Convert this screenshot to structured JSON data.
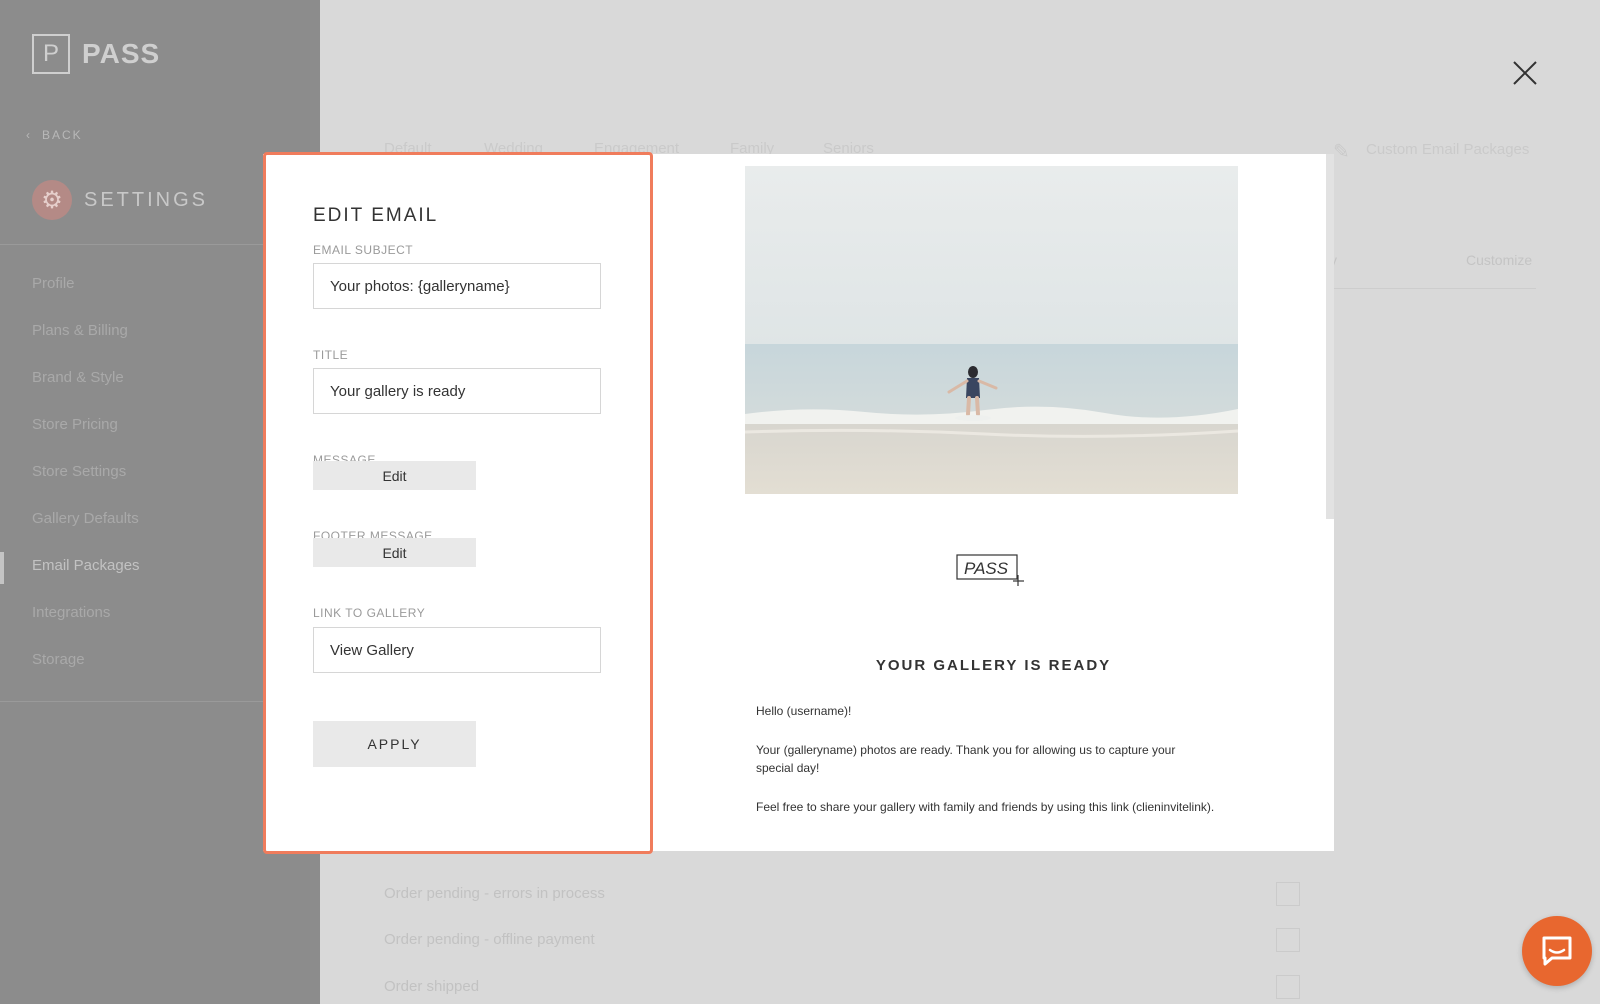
{
  "app": {
    "logo_mark": "P",
    "logo_text": "PASS",
    "back_label": "BACK",
    "section_title": "SETTINGS"
  },
  "sidebar": {
    "items": [
      {
        "label": "Profile"
      },
      {
        "label": "Plans & Billing"
      },
      {
        "label": "Brand & Style"
      },
      {
        "label": "Store Pricing"
      },
      {
        "label": "Store Settings"
      },
      {
        "label": "Gallery Defaults"
      },
      {
        "label": "Email Packages",
        "active": true
      },
      {
        "label": "Integrations"
      },
      {
        "label": "Storage"
      }
    ]
  },
  "background": {
    "tabs": [
      "Default",
      "Wedding",
      "Engagement",
      "Family",
      "Seniors"
    ],
    "custom_packages_label": "Custom Email Packages",
    "column_fragment": "y",
    "customize_label": "Customize",
    "rows": [
      "Order pending - errors in process",
      "Order pending - offline payment",
      "Order shipped"
    ]
  },
  "edit_form": {
    "title": "EDIT EMAIL",
    "email_subject_label": "EMAIL SUBJECT",
    "email_subject_value": "Your photos: {galleryname}",
    "title_label": "TITLE",
    "title_value": "Your gallery is ready",
    "message_label": "MESSAGE",
    "message_button": "Edit",
    "footer_label": "FOOTER MESSAGE",
    "footer_button": "Edit",
    "link_label": "LINK TO GALLERY",
    "link_value": "View Gallery",
    "apply_button": "APPLY"
  },
  "preview": {
    "logo_text": "PASS",
    "title": "YOUR GALLERY IS READY",
    "paragraphs": [
      "Hello (username)!",
      "Your (galleryname) photos are ready. Thank you for allowing us to capture your special day!",
      "Feel free to share your gallery with family and friends by using this link (clieninvitelink)."
    ]
  },
  "icons": {
    "close": "close-icon",
    "chat": "chat-icon",
    "settings": "gear-icon",
    "back": "chevron-left-icon",
    "edit": "pencil-icon"
  },
  "colors": {
    "accent": "#f07c5c",
    "chat": "#e8672f",
    "overlay": "#d9d9d9",
    "sidebar": "#8c8c8c"
  }
}
